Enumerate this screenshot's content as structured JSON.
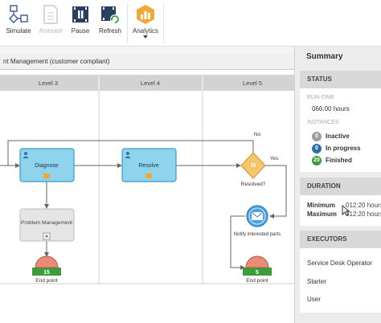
{
  "toolbar": {
    "simulate": "Simulate",
    "animate": "Animate",
    "pause": "Pause",
    "refresh": "Refresh",
    "analytics": "Analytics"
  },
  "diagram": {
    "pool_title": "nt Management (customer compliant)",
    "lanes": [
      "Level 3",
      "Level 4",
      "Level 5"
    ],
    "tasks": {
      "diagnose": "Diagnose",
      "resolve": "Resolve",
      "problem_management": "Problem Management"
    },
    "gateway_label": "Resolved?",
    "flow_yes": "Yes",
    "flow_no": "No",
    "notify_label": "Notify interested parts",
    "end_points": [
      {
        "count": "15",
        "label": "End point"
      },
      {
        "count": "5",
        "label": "End point"
      }
    ]
  },
  "summary": {
    "title": "Summary",
    "status_head": "STATUS",
    "runtime_label": "RUN-TIME",
    "runtime_value": "066:00 hours",
    "instances_label": "INSTANCES",
    "instances": [
      {
        "count": "0",
        "label": "Inactive",
        "color": "#9e9e9e"
      },
      {
        "count": "0",
        "label": "In progress",
        "color": "#2f6fa8"
      },
      {
        "count": "20",
        "label": "Finished",
        "color": "#3e9a3e"
      }
    ],
    "duration_head": "DURATION",
    "minimum_label": "Minimum",
    "minimum_value": "012:20 hours",
    "maximum_label": "Maximum",
    "maximum_value": "012:20 hours",
    "executors_head": "EXECUTORS",
    "executors": [
      "Service Desk Operator",
      "Starter",
      "User"
    ]
  },
  "colors": {
    "task_fill": "#8fd3ec",
    "task_border": "#3a9bc4",
    "gateway_fill": "#f4c76b",
    "end_fill": "#e98b78",
    "count_bar": "#3f9a3c",
    "analytics_icon": "#f2a73b"
  }
}
